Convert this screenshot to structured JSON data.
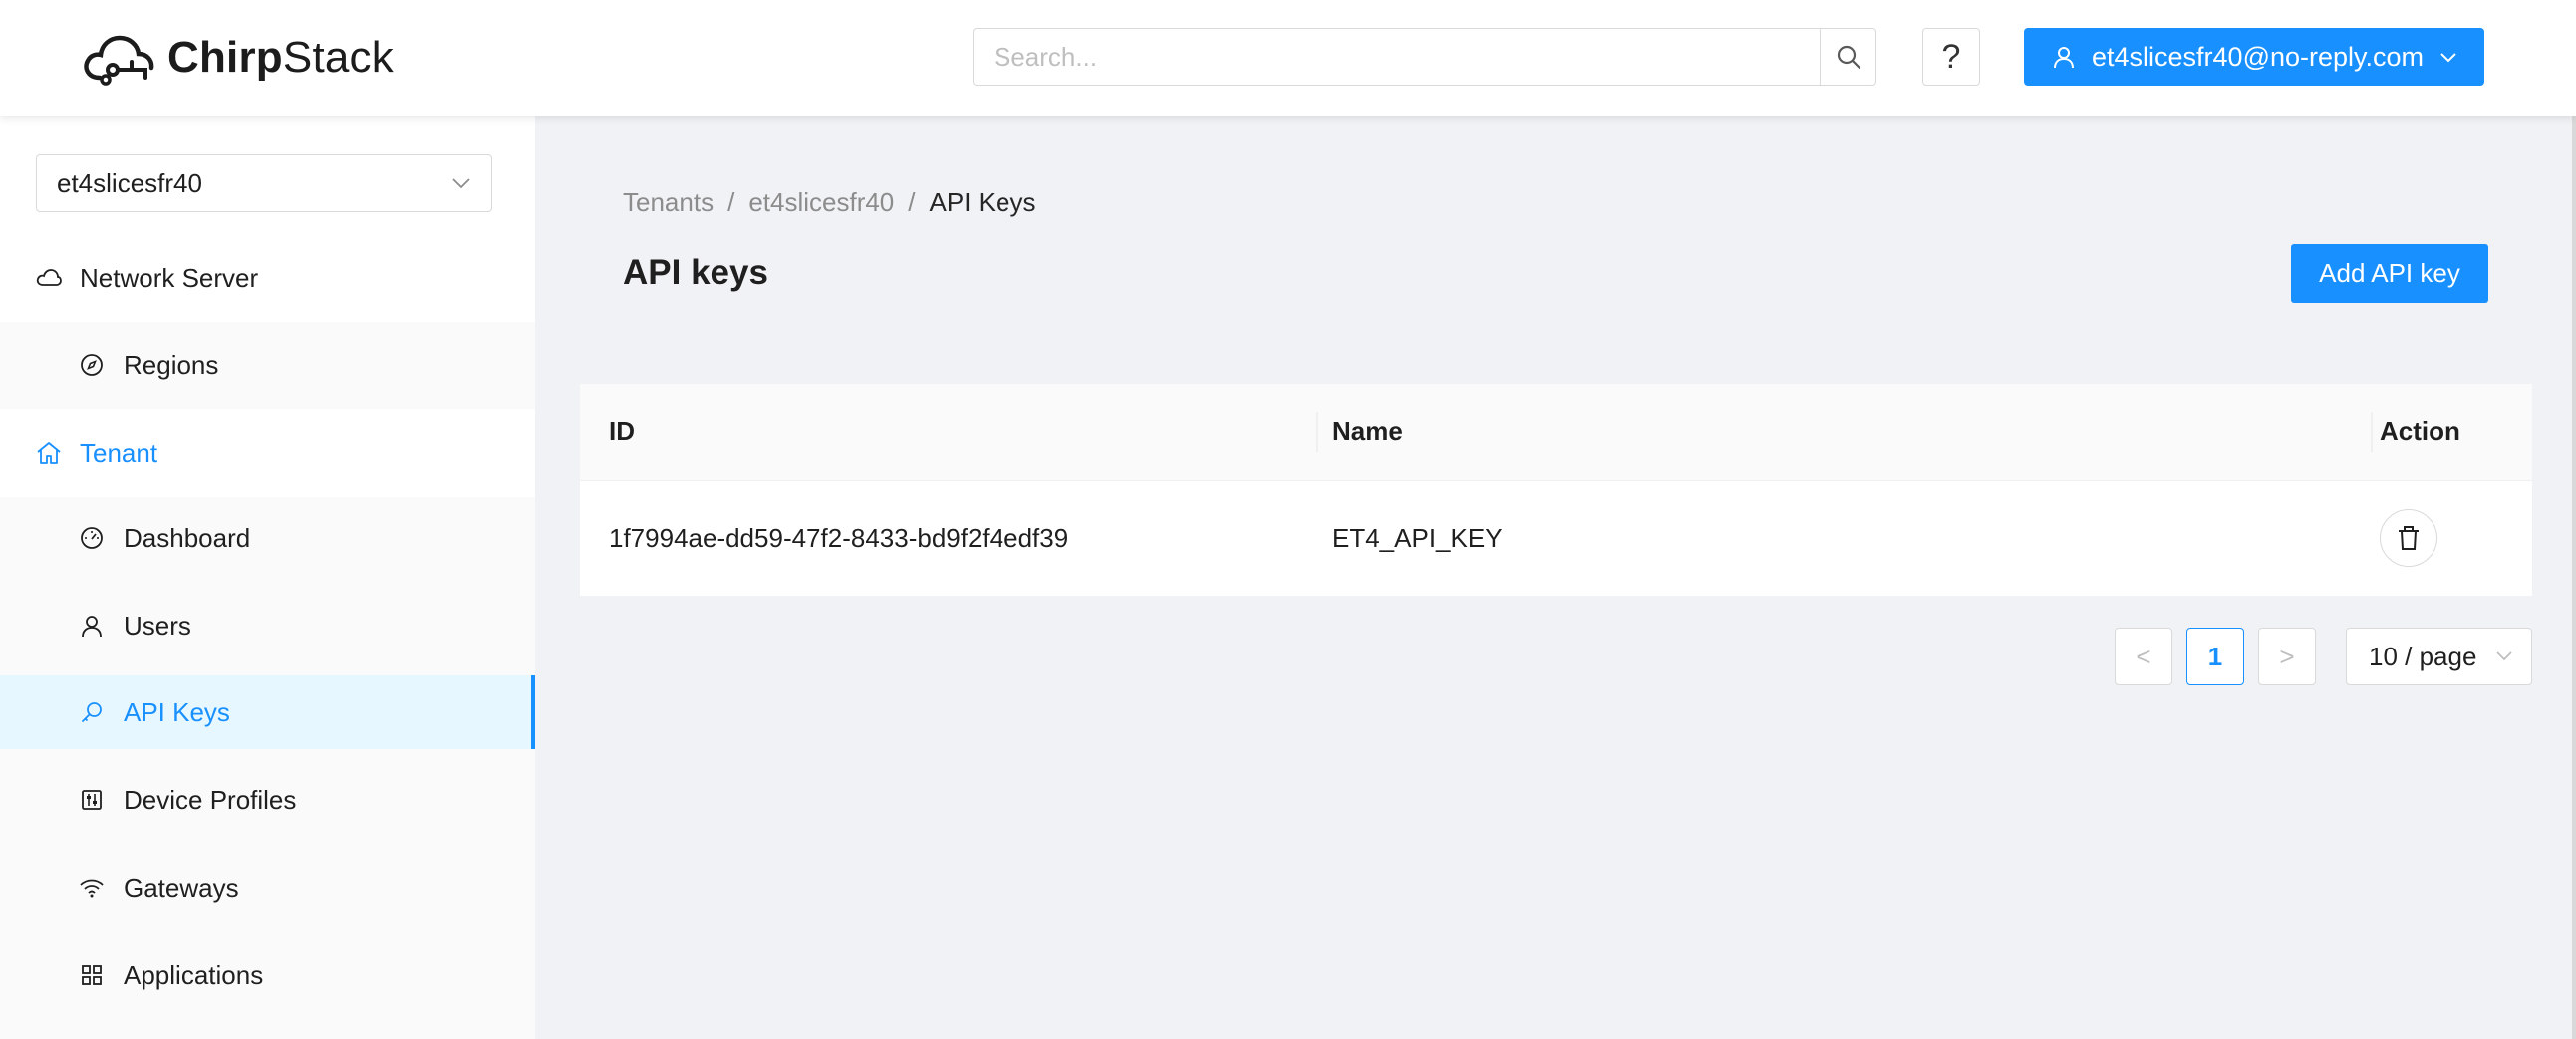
{
  "header": {
    "logo_text_bold": "Chirp",
    "logo_text_regular": "Stack",
    "search_placeholder": "Search...",
    "help_label": "?",
    "user_email": "et4slicesfr40@no-reply.com"
  },
  "sidebar": {
    "tenant_select_value": "et4slicesfr40",
    "groups": [
      {
        "label": "Network Server",
        "icon": "cloud-icon"
      },
      {
        "label": "Tenant",
        "icon": "home-icon",
        "active": true
      }
    ],
    "items": [
      {
        "label": "Regions",
        "icon": "compass-icon"
      },
      {
        "label": "Dashboard",
        "icon": "dashboard-icon"
      },
      {
        "label": "Users",
        "icon": "user-icon"
      },
      {
        "label": "API Keys",
        "icon": "key-icon",
        "selected": true
      },
      {
        "label": "Device Profiles",
        "icon": "control-icon"
      },
      {
        "label": "Gateways",
        "icon": "wifi-icon"
      },
      {
        "label": "Applications",
        "icon": "appstore-icon"
      }
    ]
  },
  "breadcrumb": {
    "items": [
      "Tenants",
      "et4slicesfr40",
      "API Keys"
    ],
    "separator": "/"
  },
  "page": {
    "title": "API keys",
    "add_button": "Add API key"
  },
  "table": {
    "columns": [
      "ID",
      "Name",
      "Action"
    ],
    "rows": [
      {
        "id": "1f7994ae-dd59-47f2-8433-bd9f2f4edf39",
        "name": "ET4_API_KEY"
      }
    ]
  },
  "pagination": {
    "prev": "<",
    "current_page": "1",
    "next": ">",
    "page_size": "10 / page"
  },
  "colors": {
    "accent": "#1890ff",
    "selected_bg": "#e6f7ff",
    "content_bg": "#f0f2f5"
  }
}
